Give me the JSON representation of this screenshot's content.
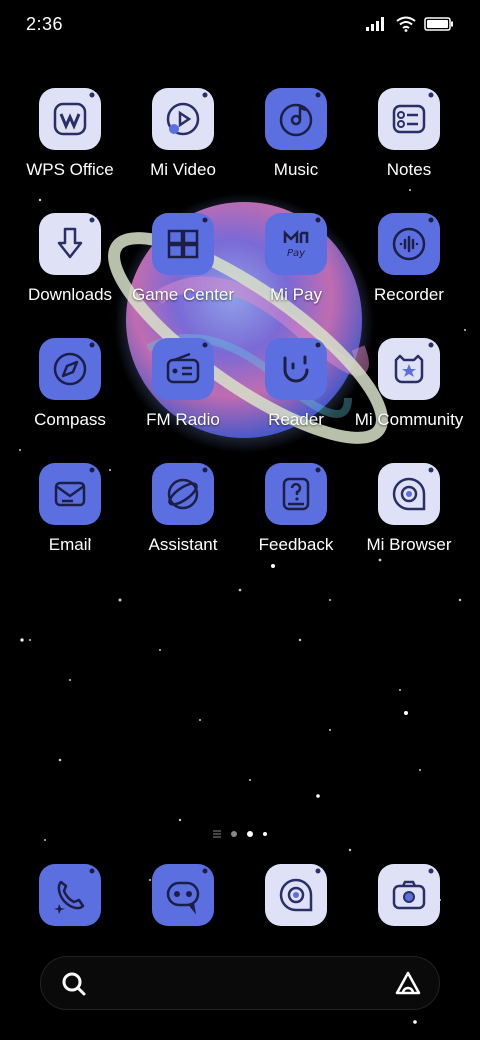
{
  "status": {
    "time": "2:36"
  },
  "apps": [
    {
      "label": "WPS Office",
      "icon": "wps-icon",
      "style": "light"
    },
    {
      "label": "Mi Video",
      "icon": "video-icon",
      "style": "light"
    },
    {
      "label": "Music",
      "icon": "music-icon",
      "style": "blue"
    },
    {
      "label": "Notes",
      "icon": "notes-icon",
      "style": "light"
    },
    {
      "label": "Downloads",
      "icon": "download-icon",
      "style": "light"
    },
    {
      "label": "Game Center",
      "icon": "game-icon",
      "style": "blue"
    },
    {
      "label": "Mi Pay",
      "icon": "pay-icon",
      "style": "blue"
    },
    {
      "label": "Recorder",
      "icon": "recorder-icon",
      "style": "blue"
    },
    {
      "label": "Compass",
      "icon": "compass-icon",
      "style": "blue"
    },
    {
      "label": "FM Radio",
      "icon": "radio-icon",
      "style": "blue"
    },
    {
      "label": "Reader",
      "icon": "reader-icon",
      "style": "blue"
    },
    {
      "label": "Mi Community",
      "icon": "community-icon",
      "style": "light"
    },
    {
      "label": "Email",
      "icon": "email-icon",
      "style": "blue"
    },
    {
      "label": "Assistant",
      "icon": "assistant-icon",
      "style": "blue"
    },
    {
      "label": "Feedback",
      "icon": "feedback-icon",
      "style": "blue"
    },
    {
      "label": "Mi Browser",
      "icon": "browser-icon",
      "style": "light"
    }
  ],
  "dock": [
    {
      "icon": "phone-icon",
      "style": "blue"
    },
    {
      "icon": "messages-icon",
      "style": "blue"
    },
    {
      "icon": "browser-icon",
      "style": "light"
    },
    {
      "icon": "camera-icon",
      "style": "light"
    }
  ],
  "colors": {
    "accent": "#5c6fe0",
    "light_icon": "#dfe2f7",
    "background": "#000000"
  }
}
